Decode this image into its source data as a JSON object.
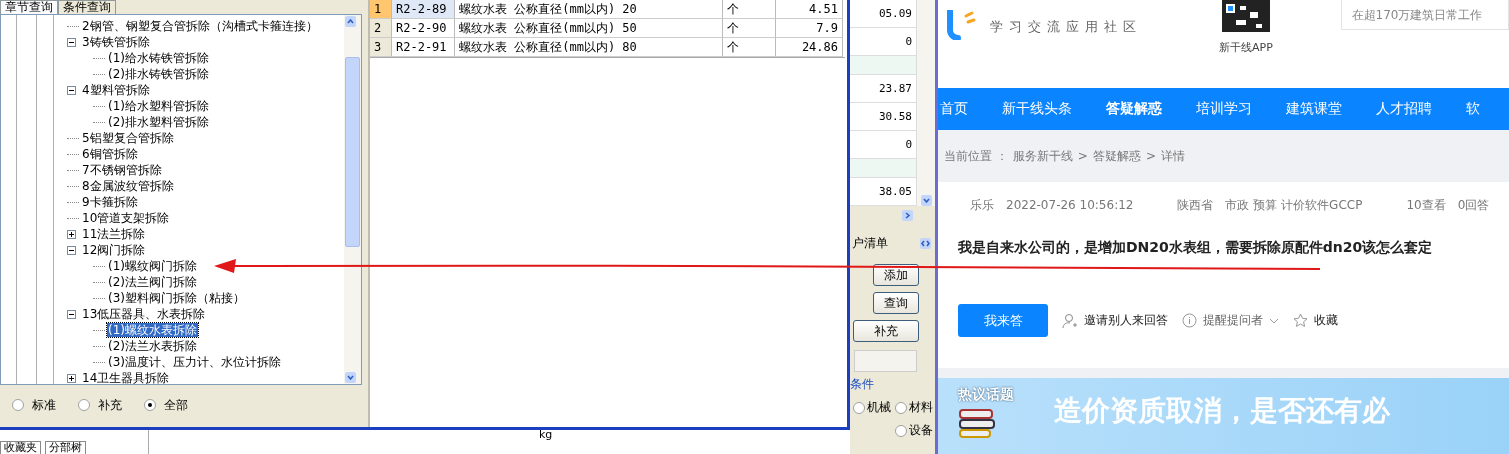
{
  "dialog": {
    "tabs": [
      {
        "label": "章节查询",
        "selected": true
      },
      {
        "label": "条件查询",
        "selected": false
      }
    ],
    "tree": [
      {
        "label": "2钢管、钢塑复合管拆除（沟槽式卡箍连接）",
        "selected": false
      },
      {
        "label": "3铸铁管拆除",
        "expanded": true,
        "selected": false,
        "children": [
          {
            "label": "(1)给水铸铁管拆除",
            "selected": false
          },
          {
            "label": "(2)排水铸铁管拆除",
            "selected": false
          }
        ]
      },
      {
        "label": "4塑料管拆除",
        "expanded": true,
        "selected": false,
        "children": [
          {
            "label": "(1)给水塑料管拆除",
            "selected": false
          },
          {
            "label": "(2)排水塑料管拆除",
            "selected": false
          }
        ]
      },
      {
        "label": "5铝塑复合管拆除",
        "selected": false
      },
      {
        "label": "6铜管拆除",
        "selected": false
      },
      {
        "label": "7不锈钢管拆除",
        "selected": false
      },
      {
        "label": "8金属波纹管拆除",
        "selected": false
      },
      {
        "label": "9卡箍拆除",
        "selected": false
      },
      {
        "label": "10管道支架拆除",
        "selected": false
      },
      {
        "label": "11法兰拆除",
        "expanded": false,
        "selected": false
      },
      {
        "label": "12阀门拆除",
        "expanded": true,
        "selected": false,
        "children": [
          {
            "label": "(1)螺纹阀门拆除",
            "selected": false
          },
          {
            "label": "(2)法兰阀门拆除",
            "selected": false
          },
          {
            "label": "(3)塑料阀门拆除（粘接）",
            "selected": false
          }
        ]
      },
      {
        "label": "13低压器具、水表拆除",
        "expanded": true,
        "selected": false,
        "children": [
          {
            "label": "(1)螺纹水表拆除",
            "selected": true
          },
          {
            "label": "(2)法兰水表拆除",
            "selected": false
          },
          {
            "label": "(3)温度计、压力计、水位计拆除",
            "selected": false
          }
        ]
      },
      {
        "label": "14卫生器具拆除",
        "expanded": false,
        "selected": false
      }
    ],
    "filter": [
      {
        "label": "标准",
        "selected": false
      },
      {
        "label": "补充",
        "selected": false
      },
      {
        "label": "全部",
        "selected": true
      }
    ],
    "table": {
      "rows": [
        {
          "index": "1",
          "code": "R2-2-89",
          "name": "螺纹水表 公称直径(mm以内) 20",
          "unit": "个",
          "value": "4.51",
          "selected": true
        },
        {
          "index": "2",
          "code": "R2-2-90",
          "name": "螺纹水表 公称直径(mm以内) 50",
          "unit": "个",
          "value": "7.9",
          "selected": false
        },
        {
          "index": "3",
          "code": "R2-2-91",
          "name": "螺纹水表 公称直径(mm以内) 80",
          "unit": "个",
          "value": "24.86",
          "selected": false
        }
      ]
    }
  },
  "background_app": {
    "rows": [
      {
        "kind": "value",
        "value": "05.09"
      },
      {
        "kind": "value",
        "value": "0"
      },
      {
        "kind": "band"
      },
      {
        "kind": "value",
        "value": "23.87"
      },
      {
        "kind": "value",
        "value": "30.58"
      },
      {
        "kind": "value",
        "value": "0"
      },
      {
        "kind": "band"
      },
      {
        "kind": "value",
        "value": "38.05"
      }
    ],
    "tab": "户清单",
    "buttons": [
      "添加",
      "查询",
      "补充"
    ],
    "group": {
      "title": "条件",
      "options": [
        {
          "label": "机械",
          "selected": false
        },
        {
          "label": "材料",
          "selected": false
        },
        {
          "label": "设备",
          "selected": false
        }
      ]
    },
    "bottom_tabs": [
      "收藏夹",
      "分部树"
    ],
    "bottom_cell": "kg"
  },
  "web": {
    "logo_tagline": "学习交流应用社区",
    "app_label": "新干线APP",
    "search": {
      "placeholder": "在超170万建筑日常工作"
    },
    "nav": [
      {
        "label": "首页",
        "selected": false
      },
      {
        "label": "新干线头条",
        "selected": false
      },
      {
        "label": "答疑解惑",
        "selected": true
      },
      {
        "label": "培训学习",
        "selected": false
      },
      {
        "label": "建筑课堂",
        "selected": false
      },
      {
        "label": "人才招聘",
        "selected": false
      },
      {
        "label": "软",
        "selected": false
      }
    ],
    "breadcrumb": [
      "当前位置 ：",
      "服务新干线",
      ">",
      "答疑解惑",
      ">",
      "详情"
    ],
    "question": {
      "author": "乐乐",
      "time": "2022-07-26 10:56:12",
      "region": "陕西省",
      "tags": "市政 预算 计价软件GCCP",
      "views": "10查看",
      "answers": "0回答",
      "title": "我是自来水公司的，是增加DN20水表组，需要拆除原配件dn20该怎么套定"
    },
    "actions": {
      "answer": "我来答",
      "invite": "邀请别人来回答",
      "remind": "提醒提问者",
      "favorite": "收藏"
    },
    "banner": {
      "badge": "热议话题",
      "headline": "造价资质取消，是否还有必"
    }
  }
}
